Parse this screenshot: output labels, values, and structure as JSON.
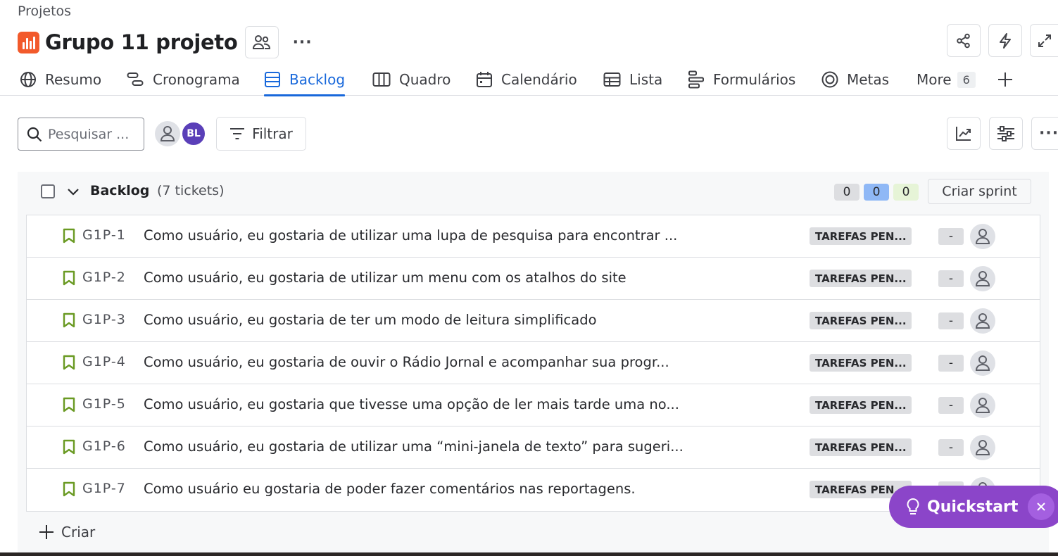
{
  "breadcrumb": "Projetos",
  "project": {
    "title": "Grupo 11 projeto",
    "icon": "project-board-icon",
    "icon_color": "#f25a2b"
  },
  "header_actions": [
    "share-icon",
    "lightning-icon",
    "expand-icon"
  ],
  "tabs": [
    {
      "label": "Resumo",
      "icon": "globe-icon"
    },
    {
      "label": "Cronograma",
      "icon": "timeline-icon"
    },
    {
      "label": "Backlog",
      "icon": "backlog-icon",
      "active": true
    },
    {
      "label": "Quadro",
      "icon": "board-icon"
    },
    {
      "label": "Calendário",
      "icon": "calendar-icon"
    },
    {
      "label": "Lista",
      "icon": "list-icon"
    },
    {
      "label": "Formulários",
      "icon": "forms-icon"
    },
    {
      "label": "Metas",
      "icon": "goal-icon"
    },
    {
      "label": "More",
      "badge": "6"
    }
  ],
  "toolbar": {
    "search_placeholder": "Pesquisar ...",
    "avatar_initials": "BL",
    "filter_label": "Filtrar"
  },
  "backlog": {
    "title": "Backlog",
    "count_label": "(7 tickets)",
    "counts": [
      {
        "value": "0",
        "color": "#dddee1"
      },
      {
        "value": "0",
        "color": "#8fb8f6"
      },
      {
        "value": "0",
        "color": "#e6f4d7"
      }
    ],
    "create_sprint_label": "Criar sprint",
    "create_label": "Criar",
    "items": [
      {
        "key": "G1P-1",
        "summary": "Como usuário, eu gostaria de utilizar uma lupa de pesquisa para encontrar ...",
        "status": "TAREFAS PEN...",
        "estimate": "-"
      },
      {
        "key": "G1P-2",
        "summary": "Como usuário, eu gostaria de utilizar um menu com os atalhos do site",
        "status": "TAREFAS PEN...",
        "estimate": "-"
      },
      {
        "key": "G1P-3",
        "summary": "Como usuário, eu gostaria de ter um modo de leitura simplificado",
        "status": "TAREFAS PEN...",
        "estimate": "-"
      },
      {
        "key": "G1P-4",
        "summary": "Como usuário, eu gostaria de ouvir o Rádio Jornal e acompanhar sua progr...",
        "status": "TAREFAS PEN...",
        "estimate": "-"
      },
      {
        "key": "G1P-5",
        "summary": "Como usuário, eu gostaria que tivesse uma opção de ler mais tarde uma no...",
        "status": "TAREFAS PEN...",
        "estimate": "-"
      },
      {
        "key": "G1P-6",
        "summary": "Como usuário, eu gostaria de utilizar uma “mini-janela de texto” para sugeri...",
        "status": "TAREFAS PEN...",
        "estimate": "-"
      },
      {
        "key": "G1P-7",
        "summary": "Como usuário eu gostaria de poder fazer comentários nas reportagens.",
        "status": "TAREFAS PEN...",
        "estimate": "-"
      }
    ]
  },
  "quickstart": {
    "label": "Quickstart",
    "color": "#8b45c9"
  },
  "colors": {
    "accent": "#1868db",
    "story_icon": "#6a9a23"
  }
}
